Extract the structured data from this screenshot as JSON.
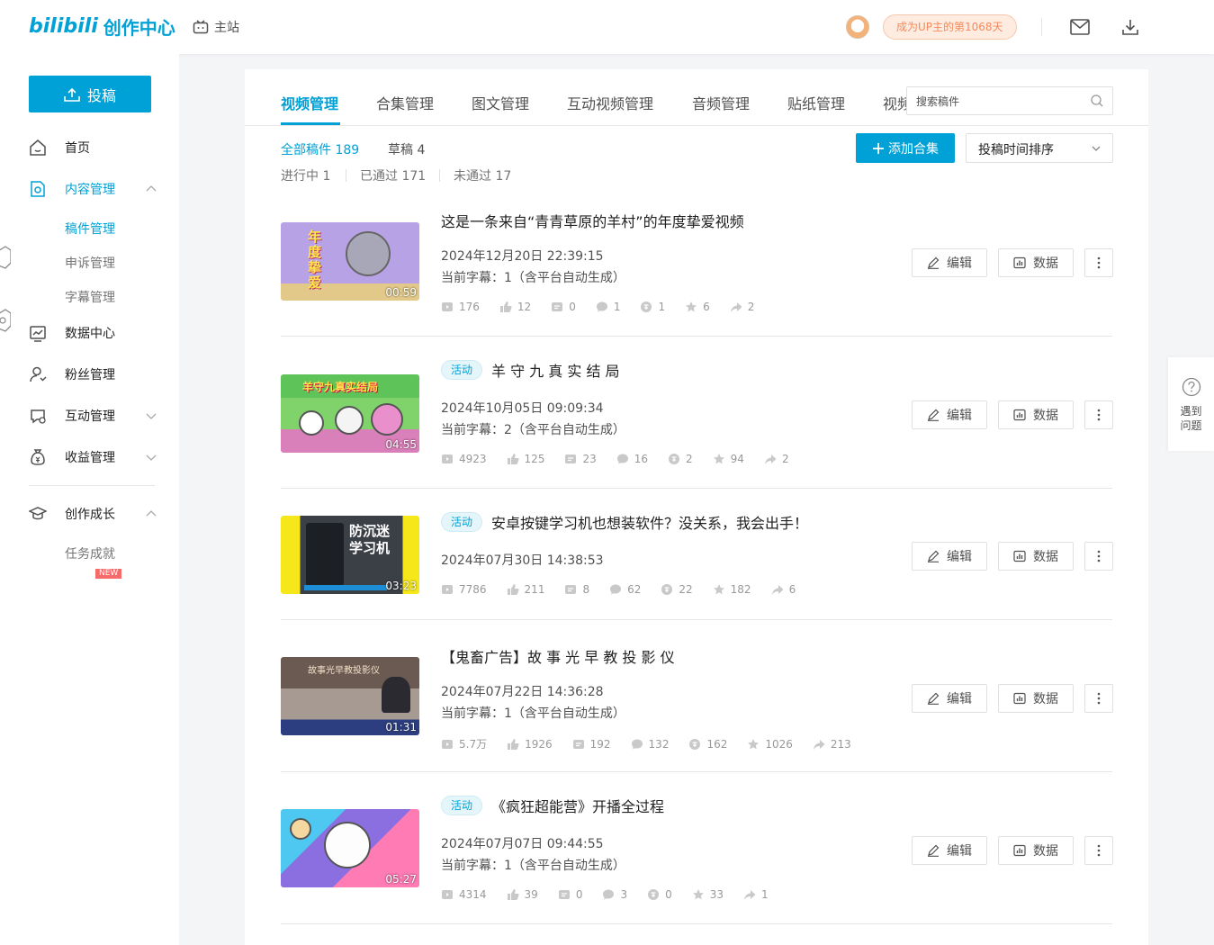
{
  "topbar": {
    "logo_text": "bilibili",
    "logo_cn": "创作中心",
    "main_site": "主站",
    "up_days": "成为UP主的第1068天"
  },
  "sidebar": {
    "submit": "投稿",
    "items": [
      {
        "label": "首页",
        "icon": "home-icon"
      },
      {
        "label": "内容管理",
        "icon": "content-icon"
      },
      {
        "label": "数据中心",
        "icon": "chart-icon"
      },
      {
        "label": "粉丝管理",
        "icon": "user-icon"
      },
      {
        "label": "互动管理",
        "icon": "chat-icon"
      },
      {
        "label": "收益管理",
        "icon": "money-bag-icon"
      },
      {
        "label": "创作成长",
        "icon": "graduation-cap-icon"
      }
    ],
    "content_sub": [
      "稿件管理",
      "申诉管理",
      "字幕管理"
    ],
    "growth_sub": [
      "任务成就"
    ],
    "new_badge": "NEW"
  },
  "tabs": [
    "视频管理",
    "合集管理",
    "图文管理",
    "互动视频管理",
    "音频管理",
    "贴纸管理",
    "视频"
  ],
  "search": {
    "placeholder": "搜索稿件"
  },
  "filters": {
    "all": "全部稿件 189",
    "draft": "草稿 4",
    "in_progress": "进行中 1",
    "passed": "已通过 171",
    "not_passed": "未通过 17"
  },
  "actions": {
    "add_collection": "添加合集",
    "sort": "投稿时间排序",
    "edit": "编辑",
    "data": "数据"
  },
  "help": {
    "label": "遇到问题"
  },
  "videos": [
    {
      "title": "这是一条来自“青青草原的羊村”的年度挚爱视频",
      "tag": "",
      "date": "2024年12月20日 22:39:15",
      "subtitle": "当前字幕：1（含平台自动生成）",
      "duration": "00:59",
      "thumb_text": "年度挚爱",
      "stats": [
        "176",
        "12",
        "0",
        "1",
        "1",
        "6",
        "2"
      ]
    },
    {
      "title": "羊 守 九 真 实 结 局",
      "tag": "活动",
      "date": "2024年10月05日 09:09:34",
      "subtitle": "当前字幕：2（含平台自动生成）",
      "duration": "04:55",
      "thumb_text": "羊守九真实结局",
      "stats": [
        "4923",
        "125",
        "23",
        "16",
        "2",
        "94",
        "2"
      ]
    },
    {
      "title": "安卓按键学习机也想装软件？没关系，我会出手！",
      "tag": "活动",
      "date": "2024年07月30日 14:38:53",
      "subtitle": "",
      "duration": "03:23",
      "thumb_text": "防沉迷 学习机",
      "stats": [
        "7786",
        "211",
        "8",
        "62",
        "22",
        "182",
        "6"
      ]
    },
    {
      "title": "【鬼畜广告】故 事 光 早 教 投 影 仪",
      "tag": "",
      "date": "2024年07月22日 14:36:28",
      "subtitle": "当前字幕：1（含平台自动生成）",
      "duration": "01:31",
      "thumb_text": "故事光早教投影仪",
      "stats": [
        "5.7万",
        "1926",
        "192",
        "132",
        "162",
        "1026",
        "213"
      ]
    },
    {
      "title": "《疯狂超能营》开播全过程",
      "tag": "活动",
      "date": "2024年07月07日 09:44:55",
      "subtitle": "当前字幕：1（含平台自动生成）",
      "duration": "05:27",
      "thumb_text": "",
      "stats": [
        "4314",
        "39",
        "0",
        "3",
        "0",
        "33",
        "1"
      ]
    }
  ],
  "colors": {
    "accent": "#00a1d6",
    "badge_bg": "#ffece0",
    "badge_text": "#f68a5c"
  }
}
